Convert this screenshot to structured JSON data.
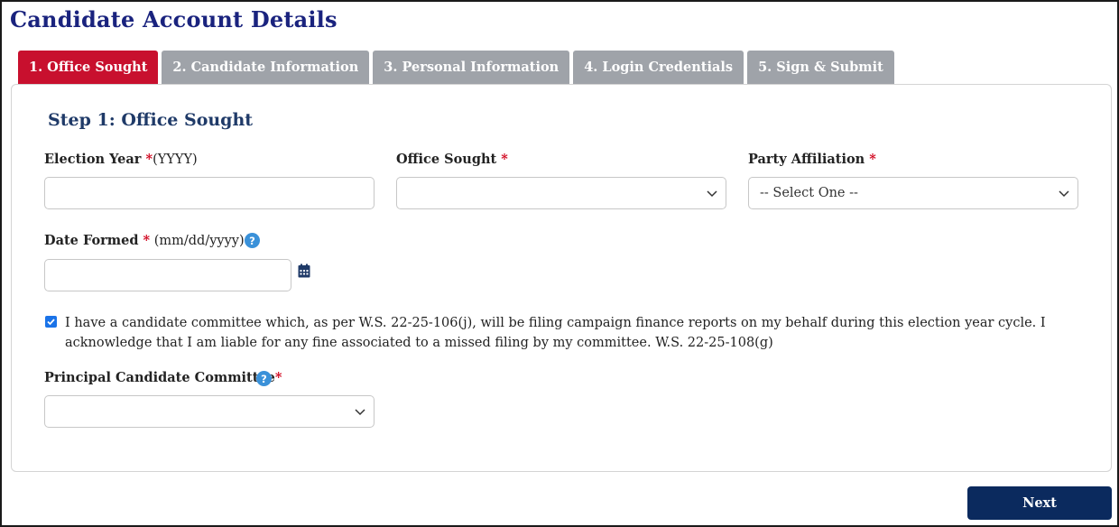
{
  "page": {
    "title": "Candidate Account Details"
  },
  "tabs": [
    {
      "label": "1. Office Sought",
      "active": true
    },
    {
      "label": "2. Candidate Information",
      "active": false
    },
    {
      "label": "3. Personal Information",
      "active": false
    },
    {
      "label": "4. Login Credentials",
      "active": false
    },
    {
      "label": "5. Sign & Submit",
      "active": false
    }
  ],
  "form": {
    "step_title": "Step 1: Office Sought",
    "election_year": {
      "label": "Election Year ",
      "required": "*",
      "hint": "(YYYY)",
      "value": ""
    },
    "office_sought": {
      "label": "Office Sought ",
      "required": "*",
      "value": ""
    },
    "party_affiliation": {
      "label": "Party Affiliation ",
      "required": "*",
      "value": "-- Select One --"
    },
    "date_formed": {
      "label": "Date Formed ",
      "required": "*",
      "hint": " (mm/dd/yyyy)",
      "value": ""
    },
    "acknowledgement": {
      "checked": true,
      "text": "I have a candidate committee which, as per W.S. 22-25-106(j), will be filing campaign finance reports on my behalf during this election year cycle. I acknowledge that I am liable for any fine associated to a missed filing by my committee. W.S. 22-25-108(g)"
    },
    "principal_committee": {
      "label": "Principal Candidate Committee",
      "required": "*",
      "value": ""
    },
    "help_glyph": "?"
  },
  "actions": {
    "next_label": "Next"
  },
  "colors": {
    "title": "#1a237e",
    "active_tab": "#c8102e",
    "inactive_tab": "#9fa3a9",
    "required": "#d0021b",
    "help": "#3a91d9",
    "primary_button": "#0b2a5e",
    "calendar": "#1f3a68"
  }
}
